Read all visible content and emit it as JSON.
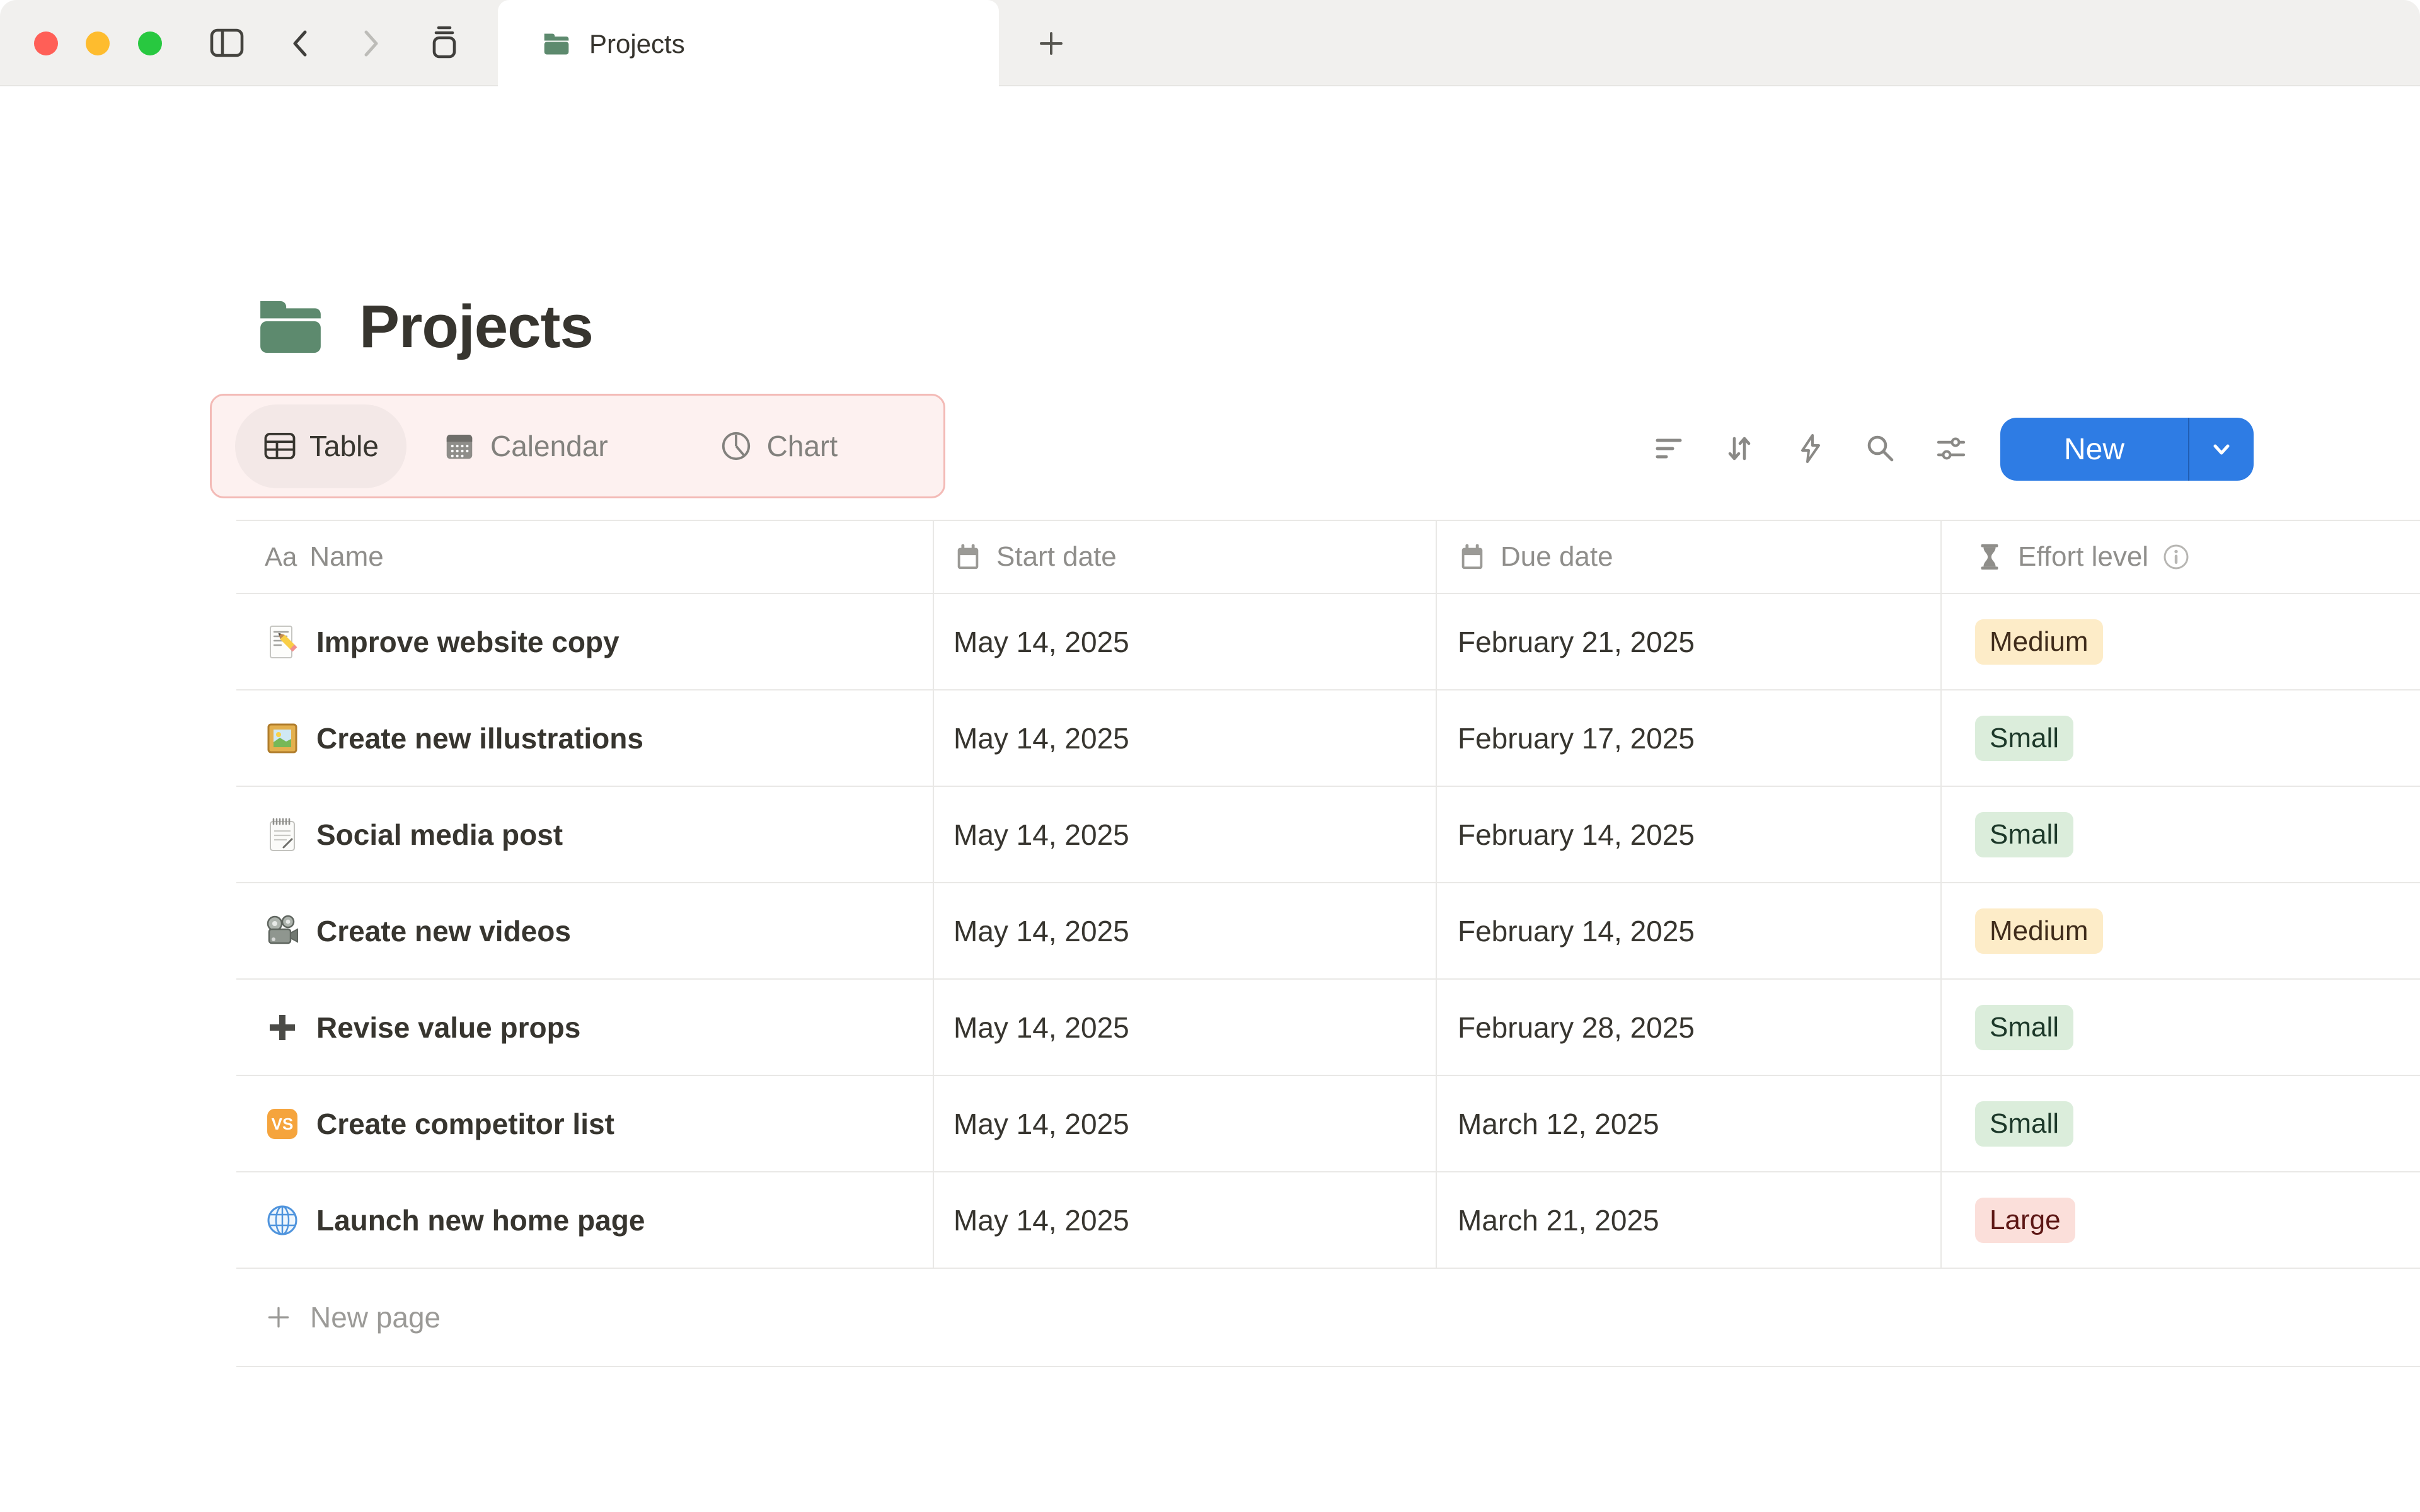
{
  "window": {
    "tab_title": "Projects",
    "traffic_lights": {
      "close": "#ff5f57",
      "minimize": "#febc2e",
      "zoom": "#28c840"
    }
  },
  "page": {
    "title": "Projects",
    "icon": "green-folder"
  },
  "views": [
    {
      "label": "Table",
      "icon": "table-grid",
      "active": true
    },
    {
      "label": "Calendar",
      "icon": "calendar",
      "active": false
    },
    {
      "label": "Chart",
      "icon": "pie-chart",
      "active": false
    }
  ],
  "toolbar": {
    "icons": [
      "filter",
      "sort",
      "automation-bolt",
      "search",
      "view-settings"
    ],
    "new_label": "New"
  },
  "table": {
    "columns": [
      {
        "label": "Name",
        "icon": "text-Aa"
      },
      {
        "label": "Start date",
        "icon": "calendar"
      },
      {
        "label": "Due date",
        "icon": "calendar"
      },
      {
        "label": "Effort level",
        "icon": "hourglass",
        "info": true
      }
    ],
    "rows": [
      {
        "icon": "memo",
        "name": "Improve website copy",
        "start": "May 14, 2025",
        "due": "February 21, 2025",
        "effort": {
          "label": "Medium",
          "color": "yellow"
        }
      },
      {
        "icon": "framed-picture",
        "name": "Create new illustrations",
        "start": "May 14, 2025",
        "due": "February 17, 2025",
        "effort": {
          "label": "Small",
          "color": "green"
        }
      },
      {
        "icon": "spiral-notepad",
        "name": "Social media post",
        "start": "May 14, 2025",
        "due": "February 14, 2025",
        "effort": {
          "label": "Small",
          "color": "green"
        }
      },
      {
        "icon": "movie-camera",
        "name": "Create new videos",
        "start": "May 14, 2025",
        "due": "February 14, 2025",
        "effort": {
          "label": "Medium",
          "color": "yellow"
        }
      },
      {
        "icon": "heavy-plus",
        "name": "Revise value props",
        "start": "May 14, 2025",
        "due": "February 28, 2025",
        "effort": {
          "label": "Small",
          "color": "green"
        }
      },
      {
        "icon": "vs-button",
        "name": "Create competitor list",
        "start": "May 14, 2025",
        "due": "March 12, 2025",
        "effort": {
          "label": "Small",
          "color": "green"
        }
      },
      {
        "icon": "globe",
        "name": "Launch new home page",
        "start": "May 14, 2025",
        "due": "March 21, 2025",
        "effort": {
          "label": "Large",
          "color": "red"
        }
      }
    ],
    "new_page_label": "New page"
  },
  "colors": {
    "accent_blue": "#2e7ce4",
    "folder_green": "#5d8a6e",
    "view_highlight_bg": "#fdf1f0",
    "view_highlight_border": "#f3bab6",
    "badge_yellow_bg": "#fdecc8",
    "badge_green_bg": "#dbeddb",
    "badge_red_bg": "#fbdfda",
    "divider": "#e9e8e6"
  }
}
